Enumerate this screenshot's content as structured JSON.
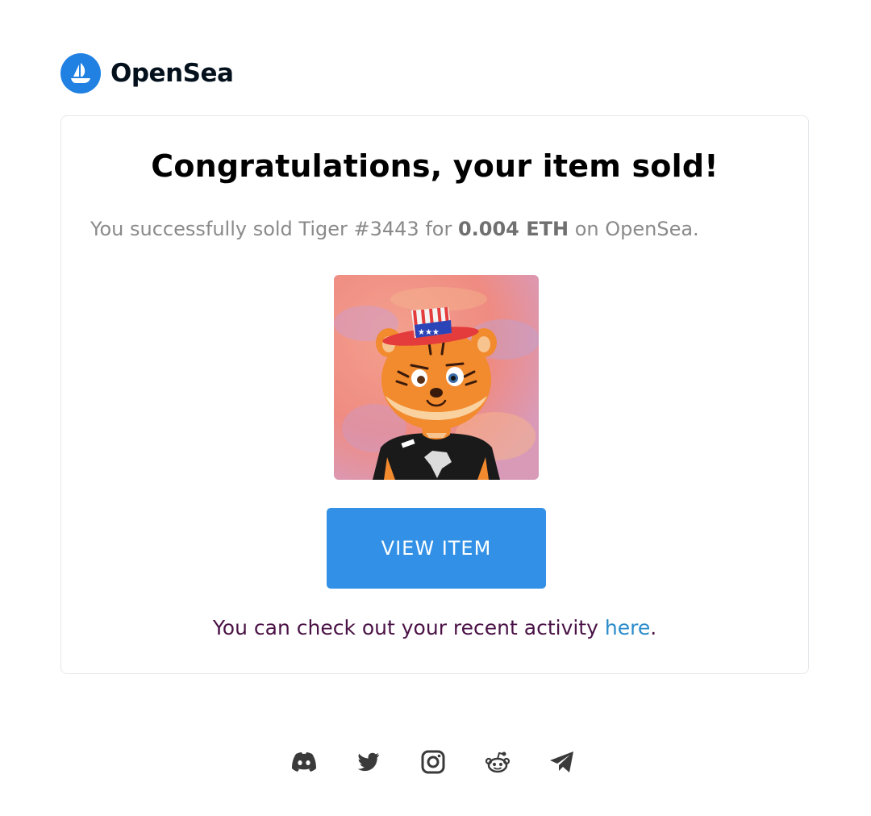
{
  "brand": {
    "name": "OpenSea",
    "logo_color": "#2081e2"
  },
  "card": {
    "title": "Congratulations, your item sold!",
    "message": {
      "prefix": "You successfully sold Tiger #3443 for ",
      "amount": "0.004 ETH",
      "suffix": " on OpenSea."
    },
    "image_alt": "Tiger #3443",
    "button_label": "VIEW ITEM",
    "button_color": "#3291e6",
    "activity": {
      "prefix": "You can check out your recent activity ",
      "link_text": "here",
      "suffix": "."
    }
  },
  "socials": [
    {
      "icon": "discord-icon"
    },
    {
      "icon": "twitter-icon"
    },
    {
      "icon": "instagram-icon"
    },
    {
      "icon": "reddit-icon"
    },
    {
      "icon": "telegram-icon"
    }
  ]
}
